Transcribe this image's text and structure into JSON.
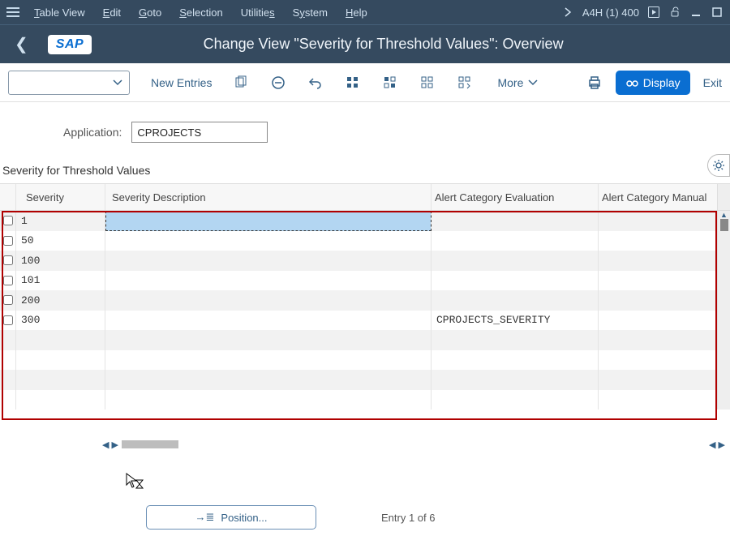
{
  "menubar": {
    "items": [
      "Table View",
      "Edit",
      "Goto",
      "Selection",
      "Utilities",
      "System",
      "Help"
    ],
    "system_label": "A4H (1) 400"
  },
  "header": {
    "title": "Change View \"Severity for Threshold Values\": Overview"
  },
  "toolbar": {
    "new_entries": "New Entries",
    "more": "More",
    "display": "Display",
    "exit": "Exit"
  },
  "application": {
    "label": "Application:",
    "value": "CPROJECTS"
  },
  "section": {
    "title": "Severity for Threshold Values"
  },
  "table": {
    "columns": {
      "severity": "Severity",
      "description": "Severity Description",
      "evaluation": "Alert Category Evaluation",
      "manual": "Alert Category Manual"
    },
    "rows": [
      {
        "severity": "1",
        "description": "",
        "evaluation": "",
        "manual": ""
      },
      {
        "severity": "50",
        "description": "",
        "evaluation": "",
        "manual": ""
      },
      {
        "severity": "100",
        "description": "",
        "evaluation": "",
        "manual": ""
      },
      {
        "severity": "101",
        "description": "",
        "evaluation": "",
        "manual": ""
      },
      {
        "severity": "200",
        "description": "",
        "evaluation": "",
        "manual": ""
      },
      {
        "severity": "300",
        "description": "",
        "evaluation": "CPROJECTS_SEVERITY",
        "manual": ""
      },
      {
        "severity": "",
        "description": "",
        "evaluation": "",
        "manual": ""
      },
      {
        "severity": "",
        "description": "",
        "evaluation": "",
        "manual": ""
      },
      {
        "severity": "",
        "description": "",
        "evaluation": "",
        "manual": ""
      },
      {
        "severity": "",
        "description": "",
        "evaluation": "",
        "manual": ""
      }
    ]
  },
  "footer": {
    "position": "Position...",
    "entry": "Entry 1 of 6"
  }
}
